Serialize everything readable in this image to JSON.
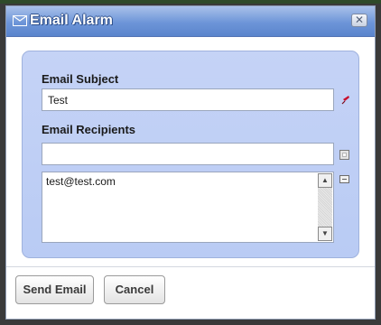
{
  "dialog": {
    "title": "Email Alarm",
    "title_icon": "envelope-icon",
    "close_icon": "close-icon",
    "close_glyph": "✕"
  },
  "form": {
    "subject_label": "Email Subject",
    "subject_value": "Test",
    "required_icon": "required-pin-icon",
    "recipients_label": "Email Recipients",
    "recipient_input_value": "",
    "add_icon": "add-recipient-icon",
    "remove_icon": "remove-recipient-icon",
    "recipients": [
      "test@test.com"
    ]
  },
  "buttons": {
    "send_label": "Send Email",
    "cancel_label": "Cancel"
  },
  "colors": {
    "titlebar": "#6d95d8",
    "panel": "#c5d3f6",
    "required_pin": "#c8102e"
  }
}
